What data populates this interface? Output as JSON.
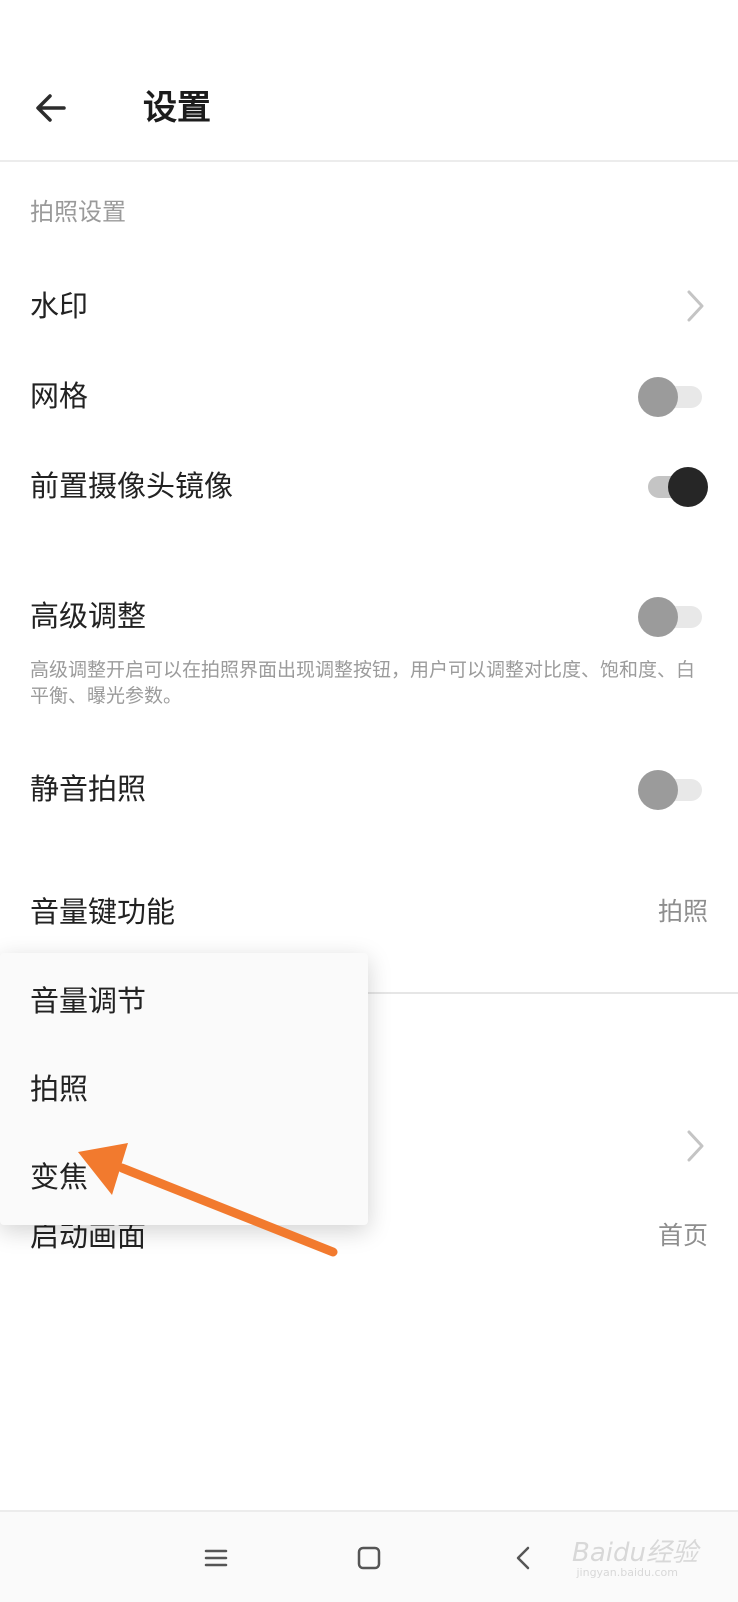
{
  "header": {
    "title": "设置",
    "back_icon": "arrow-left-icon"
  },
  "section": {
    "label": "拍照设置"
  },
  "settings": {
    "watermark": {
      "label": "水印"
    },
    "grid": {
      "label": "网格",
      "enabled": false
    },
    "mirror": {
      "label": "前置摄像头镜像",
      "enabled": true
    },
    "advanced": {
      "label": "高级调整",
      "enabled": false,
      "description": "高级调整开启可以在拍照界面出现调整按钮，用户可以调整对比度、饱和度、白平衡、曝光参数。"
    },
    "silent": {
      "label": "静音拍照",
      "enabled": false
    },
    "volume_key": {
      "label": "音量键功能",
      "value": "拍照"
    },
    "startup": {
      "label": "启动画面",
      "value": "首页"
    }
  },
  "popup": {
    "options": [
      "音量调节",
      "拍照",
      "变焦"
    ]
  },
  "navbar": {
    "menu_icon": "menu-icon",
    "home_icon": "home-square-icon",
    "back_icon": "back-chevron-icon"
  },
  "watermark_text": {
    "main": "Baidu经验",
    "sub": "jingyan.baidu.com"
  },
  "colors": {
    "annotation_arrow": "#f27a2e",
    "toggle_on": "#262626",
    "toggle_off": "#9b9b9b"
  }
}
